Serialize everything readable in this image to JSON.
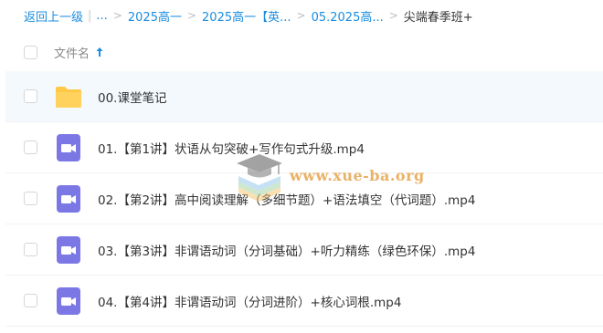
{
  "breadcrumb": {
    "back": "返回上一级",
    "pipe": "|",
    "ellipsis": "...",
    "items": [
      "2025高一",
      "2025高一【英...",
      "05.2025高..."
    ],
    "current": "尖端春季班+"
  },
  "header": {
    "column_name": "文件名",
    "sort_icon": "arrow-up-icon"
  },
  "files": [
    {
      "type": "folder",
      "icon": "folder-icon",
      "name": "00.课堂笔记"
    },
    {
      "type": "video",
      "icon": "video-file-icon",
      "name": "01.【第1讲】状语从句突破+写作句式升级.mp4"
    },
    {
      "type": "video",
      "icon": "video-file-icon",
      "name": "02.【第2讲】高中阅读理解（多细节题）+语法填空（代词题）.mp4"
    },
    {
      "type": "video",
      "icon": "video-file-icon",
      "name": "03.【第3讲】非谓语动词（分词基础）+听力精练（绿色环保）.mp4"
    },
    {
      "type": "video",
      "icon": "video-file-icon",
      "name": "04.【第4讲】非谓语动词（分词进阶）+核心词根.mp4"
    }
  ],
  "watermark": {
    "text": "www.xue-ba.org",
    "icon": "graduation-cap-icon"
  },
  "colors": {
    "link": "#1a8de0",
    "folder": "#ffc845",
    "video": "#7b78e5",
    "row_highlight": "#f3f9fd"
  }
}
